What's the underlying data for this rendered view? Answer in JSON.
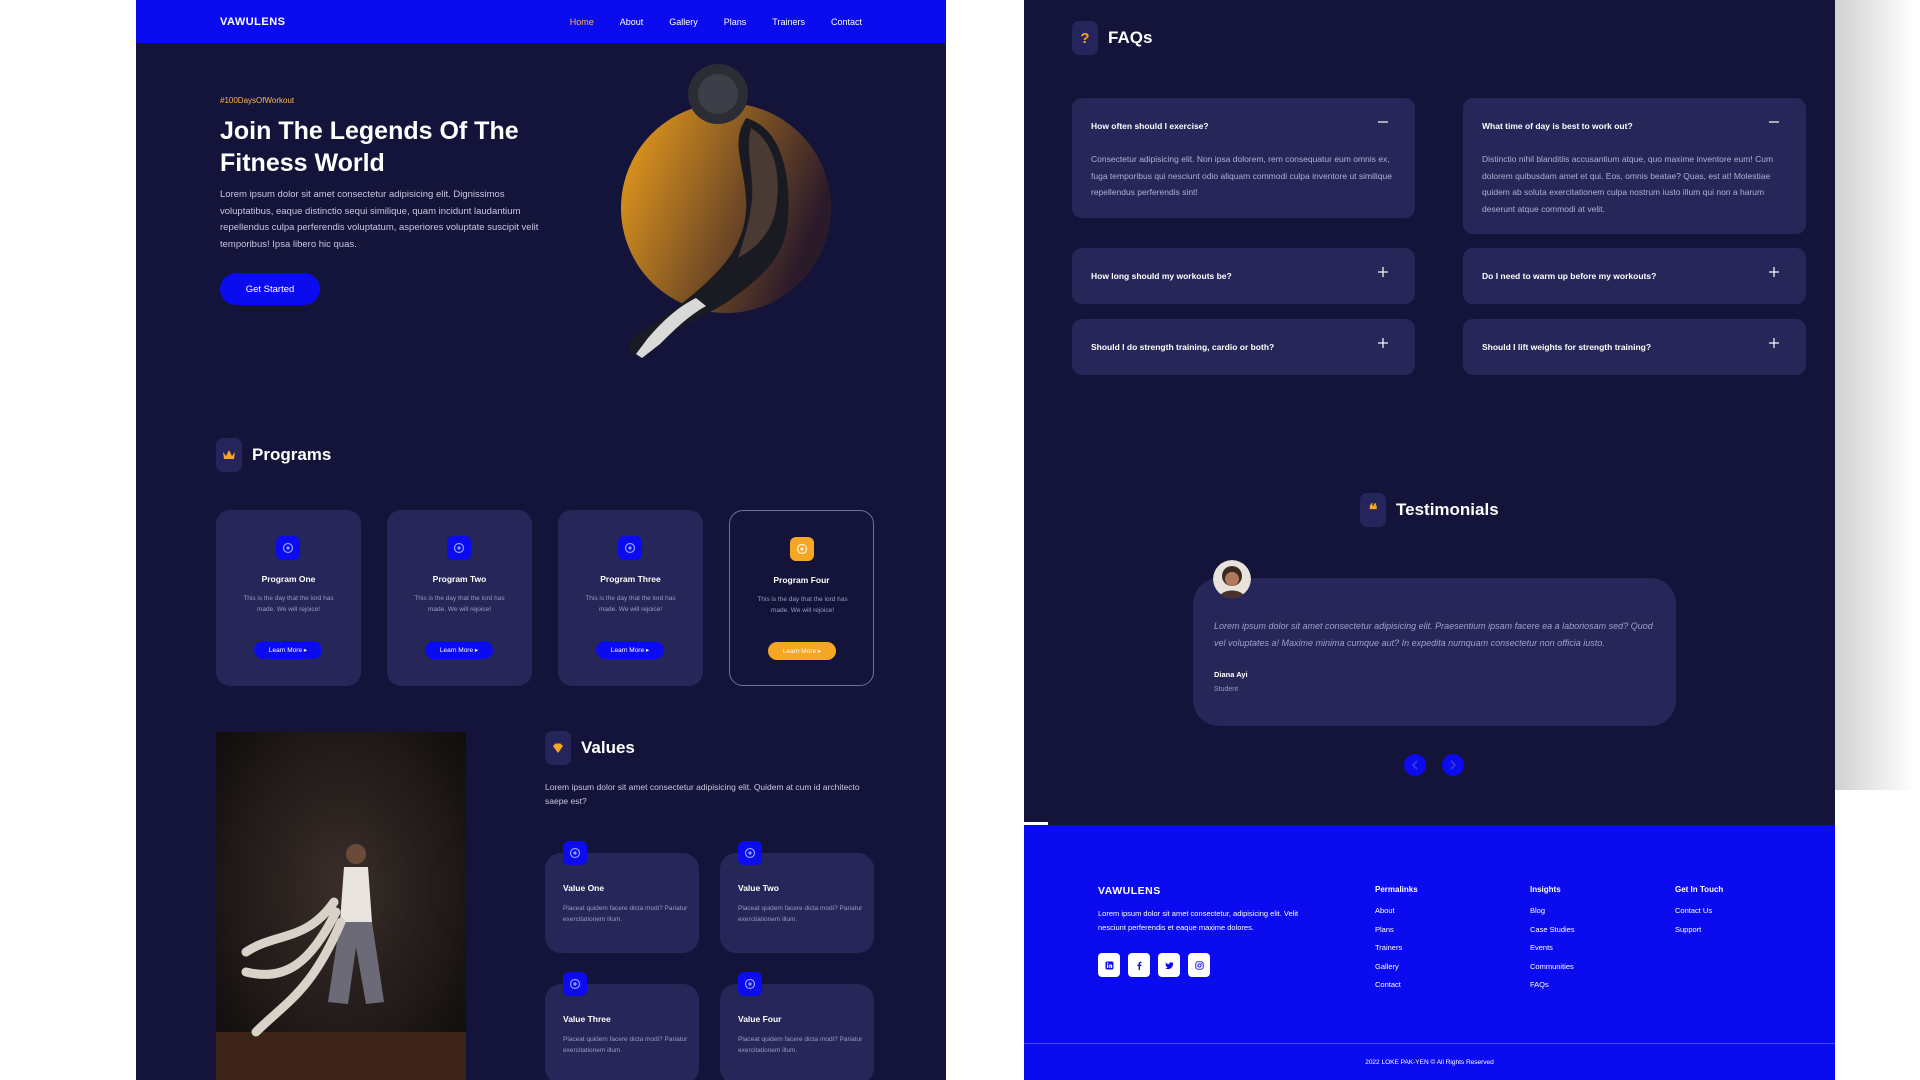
{
  "colors": {
    "accent_blue": "#0b0bf0",
    "bg_navy": "#14143a",
    "card": "#262659",
    "orange": "#f5a623",
    "tag": "#ffb54a"
  },
  "nav": {
    "logo": "VAWULENS",
    "links": [
      "Home",
      "About",
      "Gallery",
      "Plans",
      "Trainers",
      "Contact"
    ],
    "active": "Home"
  },
  "hero": {
    "tag": "#100DaysOfWorkout",
    "title": "Join The Legends Of The Fitness World",
    "description": "Lorem ipsum dolor sit amet consectetur adipisicing elit. Dignissimos voluptatibus, eaque distinctio sequi similique, quam incidunt laudantium repellendus culpa perferendis voluptatum, asperiores voluptate suscipit velit temporibus! Ipsa libero hic quas.",
    "cta": "Get Started"
  },
  "programs": {
    "title": "Programs",
    "icon": "crown-icon",
    "items": [
      {
        "title": "Program One",
        "desc": "This is the day that the lord has made. We will rejoice!",
        "btn": "Learn More ▸"
      },
      {
        "title": "Program Two",
        "desc": "This is the day that the lord has made. We will rejoice!",
        "btn": "Learn More ▸"
      },
      {
        "title": "Program Three",
        "desc": "This is the day that the lord has made. We will rejoice!",
        "btn": "Learn More ▸"
      },
      {
        "title": "Program Four",
        "desc": "This is the day that the lord has made. We will rejoice!",
        "btn": "Learn More ▸"
      }
    ]
  },
  "values": {
    "title": "Values",
    "icon": "diamond-icon",
    "description": "Lorem ipsum dolor sit amet consectetur adipisicing elit. Quidem at cum id architecto saepe est?",
    "items": [
      {
        "title": "Value One",
        "desc": "Placeat quidem facere dicta modi? Pariatur exercitationem illum."
      },
      {
        "title": "Value Two",
        "desc": "Placeat quidem facere dicta modi? Pariatur exercitationem illum."
      },
      {
        "title": "Value Three",
        "desc": "Placeat quidem facere dicta modi? Pariatur exercitationem illum."
      },
      {
        "title": "Value Four",
        "desc": "Placeat quidem facere dicta modi? Pariatur exercitationem illum."
      }
    ]
  },
  "faqs": {
    "title": "FAQs",
    "badge": "?",
    "items": [
      {
        "q": "How often should I exercise?",
        "a": "Consectetur adipisicing elit. Non ipsa dolorem, rem consequatur eum omnis ex, fuga temporibus qui nesciunt odio aliquam commodi culpa inventore ut similique repellendus perferendis sint!",
        "open": true
      },
      {
        "q": "What time of day is best to work out?",
        "a": "Distinctio nihil blanditiis accusantium atque, quo maxime inventore eum! Cum dolorem quibusdam amet et qui. Eos, omnis beatae? Quas, est at! Molestiae quidem ab soluta exercitationem culpa nostrum iusto illum qui non a harum deserunt atque commodi at velit.",
        "open": true
      },
      {
        "q": "How long should my workouts be?",
        "a": "",
        "open": false
      },
      {
        "q": "Do I need to warm up before my workouts?",
        "a": "",
        "open": false
      },
      {
        "q": "Should I do strength training, cardio or both?",
        "a": "",
        "open": false
      },
      {
        "q": "Should I lift weights for strength training?",
        "a": "",
        "open": false
      }
    ]
  },
  "testimonials": {
    "title": "Testimonials",
    "badge": "❝",
    "quote": "Lorem ipsum dolor sit amet consectetur adipisicing elit. Praesentium ipsam facere ea a laboriosam sed? Quod vel voluptates a! Maxime minima cumque aut? In expedita numquam consectetur non officia iusto.",
    "name": "Diana Ayi",
    "role": "Student",
    "prev_icon": "chevron-left-icon",
    "next_icon": "chevron-right-icon"
  },
  "footer": {
    "logo": "VAWULENS",
    "description": "Lorem ipsum dolor sit amet consectetur, adipisicing elit. Velit nesciunt perferendis et eaque maxime dolores.",
    "socials": [
      "linkedin-icon",
      "facebook-icon",
      "twitter-icon",
      "instagram-icon"
    ],
    "columns": [
      {
        "title": "Permalinks",
        "links": [
          "About",
          "Plans",
          "Trainers",
          "Gallery",
          "Contact"
        ]
      },
      {
        "title": "Insights",
        "links": [
          "Blog",
          "Case Studies",
          "Events",
          "Communities",
          "FAQs"
        ]
      },
      {
        "title": "Get In Touch",
        "links": [
          "Contact Us",
          "Support"
        ]
      }
    ],
    "copyright": "2022 LOKE PAK-YEN © All Rights Reserved"
  }
}
